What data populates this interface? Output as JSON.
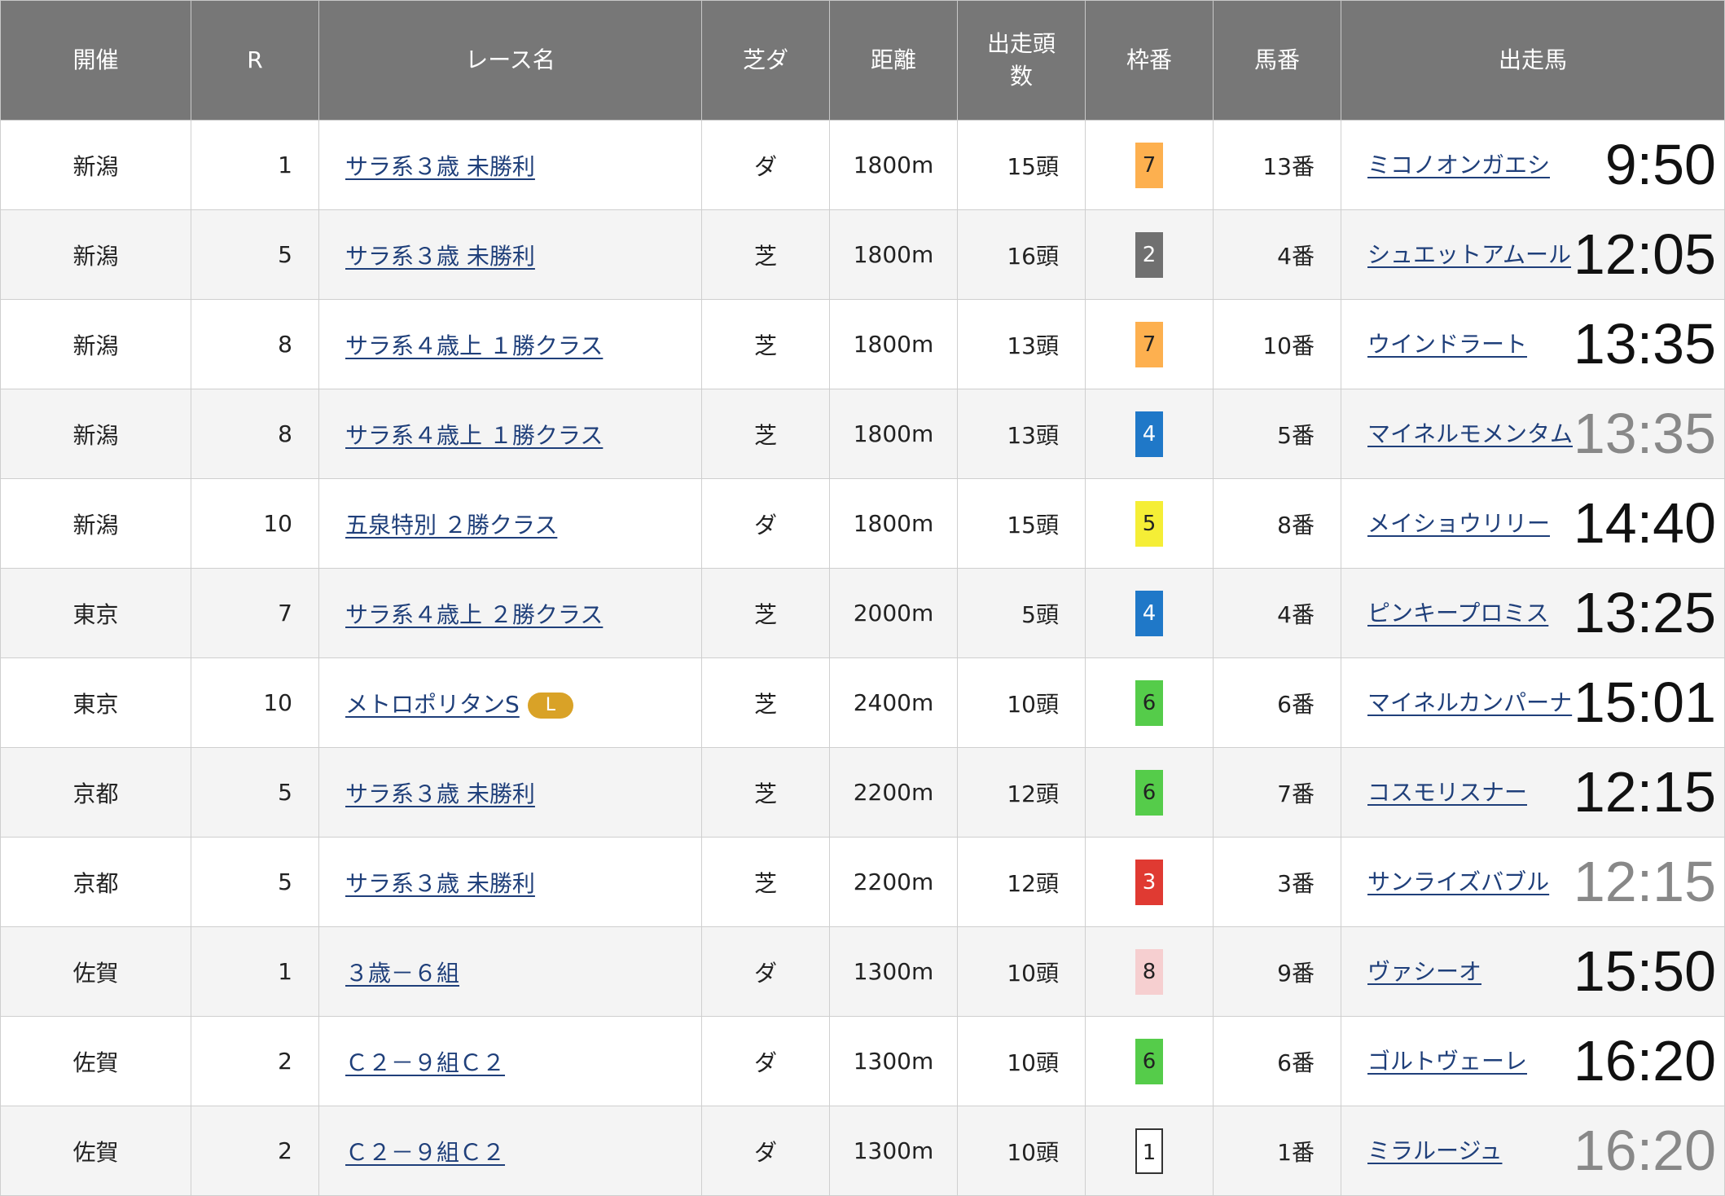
{
  "headers": {
    "kaisai": "開催",
    "race_no": "R",
    "race_name": "レース名",
    "surface": "芝ダ",
    "distance": "距離",
    "runners_line1": "出走頭",
    "runners_line2": "数",
    "waku": "枠番",
    "umaban": "馬番",
    "horse": "出走馬"
  },
  "colors": {
    "header_bg": "#777777",
    "link": "#1f3f7a",
    "badge_l": "#d9a227",
    "waku_1": "#ffffff",
    "waku_2": "#707070",
    "waku_3": "#e03a32",
    "waku_4": "#1f78c8",
    "waku_5": "#f5ee36",
    "waku_6": "#55cc4a",
    "waku_7": "#fdb04f",
    "waku_8": "#f6cfd0"
  },
  "rows": [
    {
      "kaisai": "新潟",
      "race_no": "1",
      "race_name": "サラ系３歳 未勝利",
      "badge": "",
      "surface": "ダ",
      "distance": "1800m",
      "runners": "15頭",
      "waku": "7",
      "waku_bg": "#fdb04f",
      "waku_fg": "#222222",
      "umaban": "13番",
      "horse": "ミコノオンガエシ",
      "time": "9:50",
      "time_muted": false
    },
    {
      "kaisai": "新潟",
      "race_no": "5",
      "race_name": "サラ系３歳 未勝利",
      "badge": "",
      "surface": "芝",
      "distance": "1800m",
      "runners": "16頭",
      "waku": "2",
      "waku_bg": "#707070",
      "waku_fg": "#ffffff",
      "umaban": "4番",
      "horse": "シュエットアムール",
      "time": "12:05",
      "time_muted": false
    },
    {
      "kaisai": "新潟",
      "race_no": "8",
      "race_name": "サラ系４歳上 １勝クラス",
      "badge": "",
      "surface": "芝",
      "distance": "1800m",
      "runners": "13頭",
      "waku": "7",
      "waku_bg": "#fdb04f",
      "waku_fg": "#222222",
      "umaban": "10番",
      "horse": "ウインドラート",
      "time": "13:35",
      "time_muted": false
    },
    {
      "kaisai": "新潟",
      "race_no": "8",
      "race_name": "サラ系４歳上 １勝クラス",
      "badge": "",
      "surface": "芝",
      "distance": "1800m",
      "runners": "13頭",
      "waku": "4",
      "waku_bg": "#1f78c8",
      "waku_fg": "#ffffff",
      "umaban": "5番",
      "horse": "マイネルモメンタム",
      "time": "13:35",
      "time_muted": true
    },
    {
      "kaisai": "新潟",
      "race_no": "10",
      "race_name": "五泉特別 ２勝クラス",
      "badge": "",
      "surface": "ダ",
      "distance": "1800m",
      "runners": "15頭",
      "waku": "5",
      "waku_bg": "#f5ee36",
      "waku_fg": "#222222",
      "umaban": "8番",
      "horse": "メイショウリリー",
      "time": "14:40",
      "time_muted": false
    },
    {
      "kaisai": "東京",
      "race_no": "7",
      "race_name": "サラ系４歳上 ２勝クラス",
      "badge": "",
      "surface": "芝",
      "distance": "2000m",
      "runners": "5頭",
      "waku": "4",
      "waku_bg": "#1f78c8",
      "waku_fg": "#ffffff",
      "umaban": "4番",
      "horse": "ピンキープロミス",
      "time": "13:25",
      "time_muted": false
    },
    {
      "kaisai": "東京",
      "race_no": "10",
      "race_name": "メトロポリタンS",
      "badge": "L",
      "surface": "芝",
      "distance": "2400m",
      "runners": "10頭",
      "waku": "6",
      "waku_bg": "#55cc4a",
      "waku_fg": "#222222",
      "umaban": "6番",
      "horse": "マイネルカンパーナ",
      "time": "15:01",
      "time_muted": false
    },
    {
      "kaisai": "京都",
      "race_no": "5",
      "race_name": "サラ系３歳 未勝利",
      "badge": "",
      "surface": "芝",
      "distance": "2200m",
      "runners": "12頭",
      "waku": "6",
      "waku_bg": "#55cc4a",
      "waku_fg": "#222222",
      "umaban": "7番",
      "horse": "コスモリスナー",
      "time": "12:15",
      "time_muted": false
    },
    {
      "kaisai": "京都",
      "race_no": "5",
      "race_name": "サラ系３歳 未勝利",
      "badge": "",
      "surface": "芝",
      "distance": "2200m",
      "runners": "12頭",
      "waku": "3",
      "waku_bg": "#e03a32",
      "waku_fg": "#ffffff",
      "umaban": "3番",
      "horse": "サンライズバブル",
      "time": "12:15",
      "time_muted": true
    },
    {
      "kaisai": "佐賀",
      "race_no": "1",
      "race_name": "３歳－６組",
      "badge": "",
      "surface": "ダ",
      "distance": "1300m",
      "runners": "10頭",
      "waku": "8",
      "waku_bg": "#f6cfd0",
      "waku_fg": "#222222",
      "umaban": "9番",
      "horse": "ヴァシーオ",
      "time": "15:50",
      "time_muted": false
    },
    {
      "kaisai": "佐賀",
      "race_no": "2",
      "race_name": "Ｃ２－９組Ｃ２",
      "badge": "",
      "surface": "ダ",
      "distance": "1300m",
      "runners": "10頭",
      "waku": "6",
      "waku_bg": "#55cc4a",
      "waku_fg": "#222222",
      "umaban": "6番",
      "horse": "ゴルトヴェーレ",
      "time": "16:20",
      "time_muted": false
    },
    {
      "kaisai": "佐賀",
      "race_no": "2",
      "race_name": "Ｃ２－９組Ｃ２",
      "badge": "",
      "surface": "ダ",
      "distance": "1300m",
      "runners": "10頭",
      "waku": "1",
      "waku_bg": "#ffffff",
      "waku_fg": "#222222",
      "umaban": "1番",
      "horse": "ミラルージュ",
      "time": "16:20",
      "time_muted": true
    }
  ]
}
